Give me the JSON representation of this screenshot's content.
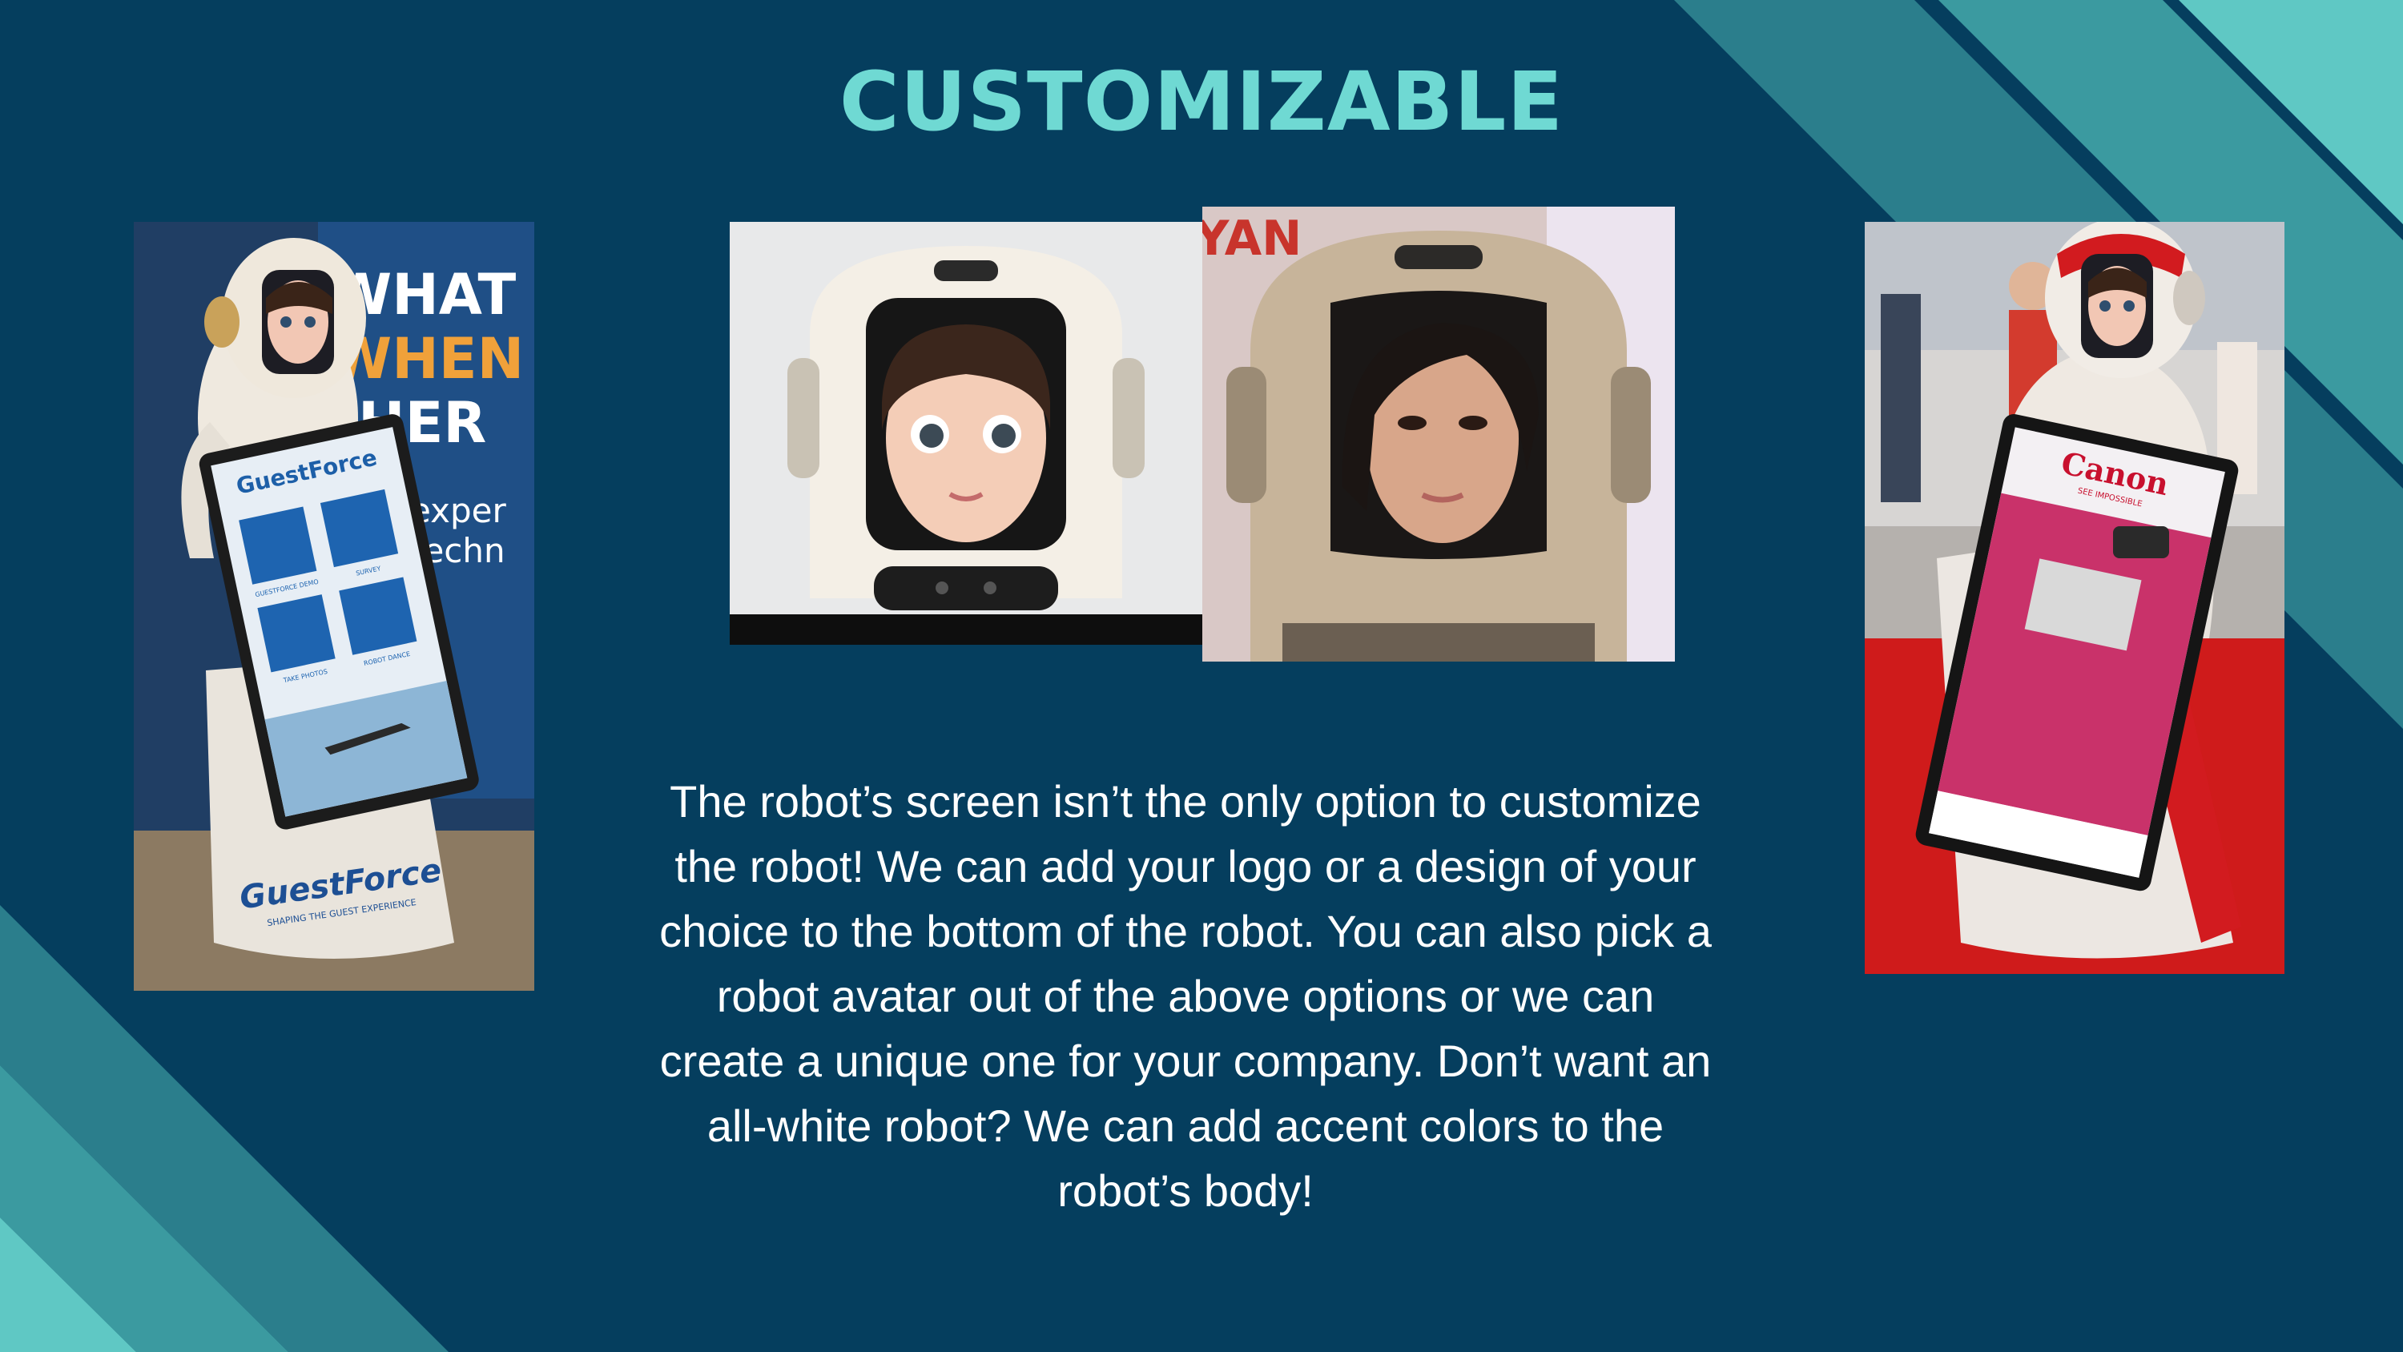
{
  "slide": {
    "title": "CUSTOMIZABLE",
    "body": "The robot’s screen isn’t the only option to customize the robot! We can add your logo or a design of your choice to the bottom of the robot. You can also pick a robot avatar out of the above options or we can create a unique one for your company. Don’t want an all-white robot? We can add accent colors to the robot’s body!"
  },
  "colors": {
    "background": "#053e5e",
    "title": "#6fd9d3",
    "stripe_dark": "#2b7e8c",
    "stripe_mid": "#3b9aa0",
    "stripe_light": "#5fc8c4"
  },
  "photos": {
    "left_robot": {
      "banner_lines": [
        "WHAT",
        "WHEN",
        "HER"
      ],
      "banner_sub": [
        "exper",
        "techn"
      ],
      "brand": "GuestForce",
      "tagline": "SHAPING THE GUEST EXPERIENCE",
      "screen_tiles": [
        "GUESTFORCE DEMO",
        "SURVEY",
        "TAKE PHOTOS",
        "ROBOT DANCE"
      ]
    },
    "avatar_cartoon": {},
    "avatar_realistic": {
      "background_text": "YAN"
    },
    "right_robot": {
      "brand": "Canon",
      "tagline": "SEE IMPOSSIBLE"
    }
  }
}
